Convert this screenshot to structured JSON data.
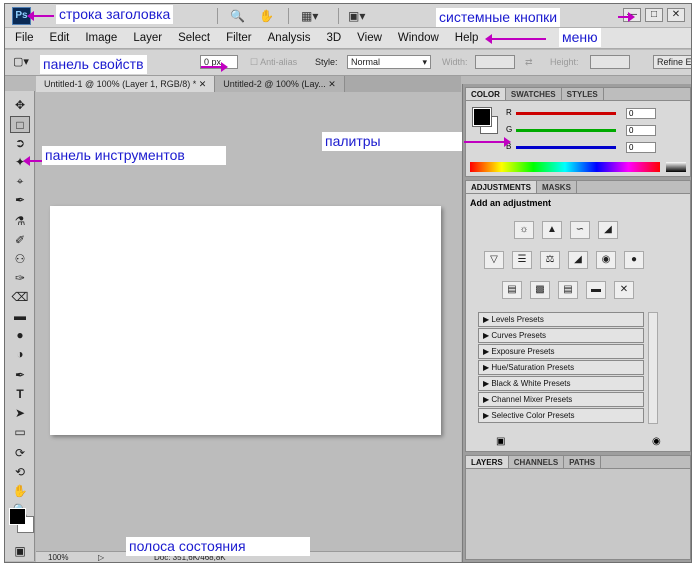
{
  "app": {
    "logo": "Ps"
  },
  "menu": [
    "File",
    "Edit",
    "Image",
    "Layer",
    "Select",
    "Filter",
    "Analysis",
    "3D",
    "View",
    "Window",
    "Help"
  ],
  "options_bar": {
    "feather_value": "0 px",
    "anti_alias": "Anti-alias",
    "style_label": "Style:",
    "style_value": "Normal",
    "width_label": "Width:",
    "height_label": "Height:",
    "refine": "Refine E"
  },
  "documents": [
    {
      "title": "Untitled-1 @ 100% (Layer 1, RGB/8) *"
    },
    {
      "title": "Untitled-2 @ 100% (Lay..."
    }
  ],
  "status_bar": {
    "zoom": "100%",
    "doc_info": "Doc: 351,6K/468,8K"
  },
  "color_panel": {
    "tabs": [
      "COLOR",
      "SWATCHES",
      "STYLES"
    ],
    "channels": [
      {
        "label": "R",
        "value": "0",
        "color": "#cc0000"
      },
      {
        "label": "G",
        "value": "0",
        "color": "#00aa00"
      },
      {
        "label": "B",
        "value": "0",
        "color": "#0000cc"
      }
    ]
  },
  "adjustments_panel": {
    "tabs": [
      "ADJUSTMENTS",
      "MASKS"
    ],
    "heading": "Add an adjustment",
    "presets": [
      "Levels Presets",
      "Curves Presets",
      "Exposure Presets",
      "Hue/Saturation Presets",
      "Black & White Presets",
      "Channel Mixer Presets",
      "Selective Color Presets"
    ]
  },
  "layers_panel": {
    "tabs": [
      "LAYERS",
      "CHANNELS",
      "PATHS"
    ]
  },
  "annotations": {
    "title_bar": "строка заголовка",
    "system_buttons": "системные кнопки",
    "menu": "меню",
    "options_bar": "панель свойств",
    "palettes": "палитры",
    "toolbox": "панель инструментов",
    "status_bar": "полоса состояния"
  }
}
